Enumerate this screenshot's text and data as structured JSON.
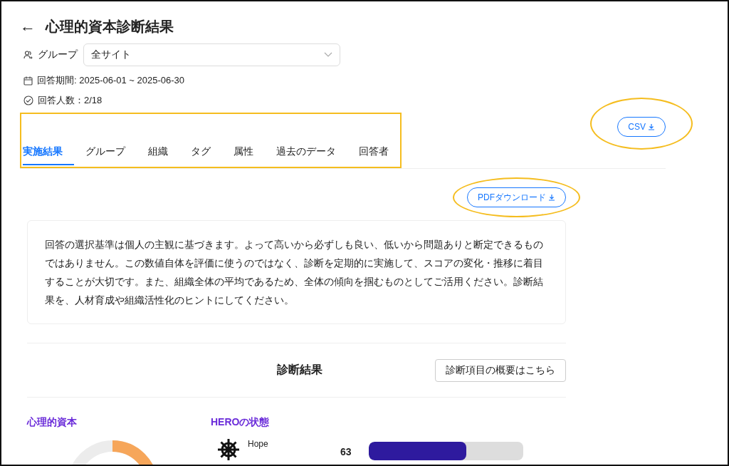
{
  "header": {
    "back_icon": "←",
    "title": "心理的資本診断結果"
  },
  "group_filter": {
    "label": "グループ",
    "value": "全サイト"
  },
  "period": "回答期間: 2025-06-01 ~ 2025-06-30",
  "respondents": "回答人数：2/18",
  "csv_button": {
    "label": "CSV",
    "highlighted": true
  },
  "tabs": {
    "highlighted": true,
    "items": [
      {
        "label": "実施結果",
        "selected": true
      },
      {
        "label": "グループ",
        "selected": false
      },
      {
        "label": "組織",
        "selected": false
      },
      {
        "label": "タグ",
        "selected": false
      },
      {
        "label": "属性",
        "selected": false
      },
      {
        "label": "過去のデータ",
        "selected": false
      },
      {
        "label": "回答者",
        "selected": false
      }
    ]
  },
  "pdf_button": {
    "label": "PDFダウンロード",
    "highlighted": true
  },
  "notice": "回答の選択基準は個人の主観に基づきます。よって高いから必ずしも良い、低いから問題ありと断定できるものではありません。この数値自体を評価に使うのではなく、診断を定期的に実施して、スコアの変化・推移に着目することが大切です。また、組織全体の平均であるため、全体の傾向を掴むものとしてご活用ください。診断結果を、人材育成や組織活性化のヒントにしてください。",
  "results": {
    "title": "診断結果",
    "overview_button": "診断項目の概要はこちら",
    "psycap_title": "心理的資本",
    "hero_title": "HEROの状態",
    "hero_items": [
      {
        "name": "Hope",
        "score": "63",
        "level": 0.63
      }
    ]
  }
}
